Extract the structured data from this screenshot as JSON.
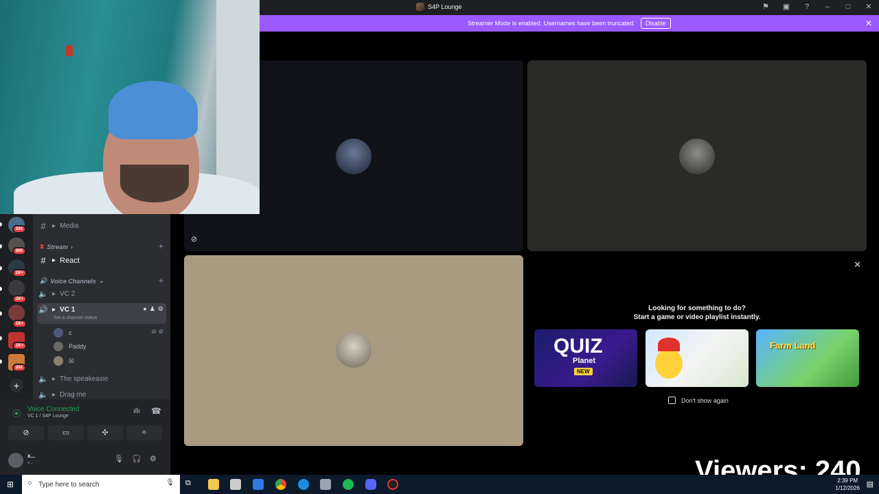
{
  "window": {
    "title": "S4P Lounge"
  },
  "banner": {
    "text": "Streamer Mode is enabled. Usernames have been truncated.",
    "button": "Disable"
  },
  "servers": [
    {
      "badge": "592"
    },
    {
      "badge": "890"
    },
    {
      "badge": "2K+"
    },
    {
      "badge": "2K+"
    },
    {
      "badge": "1K+"
    },
    {
      "badge": "1K+"
    },
    {
      "badge": "282"
    }
  ],
  "channels": {
    "media": "Media",
    "stream_category": "Stream",
    "react": "React",
    "voice_category": "Voice Channels",
    "vc2": "VC 2",
    "vc1": "VC 1",
    "vc1_status": "Set a channel status",
    "speakeasie": "The speakeasie",
    "dragme": "Drag me",
    "members": [
      {
        "name": "c"
      },
      {
        "name": "Paddy"
      },
      {
        "name": "☒"
      }
    ]
  },
  "voice": {
    "status": "Voice Connected",
    "location": "VC 1 / S4P Lounge"
  },
  "user": {
    "name": "x...",
    "status": "x..."
  },
  "activity": {
    "heading1": "Looking for something to do?",
    "heading2": "Start a game or video playlist instantly.",
    "games": [
      {
        "title": "QUIZ",
        "subtitle": "Planet",
        "tag": "NEW"
      },
      {
        "title": ""
      },
      {
        "title": "Farm Land"
      }
    ],
    "dont_show": "Don't show again"
  },
  "overlay": {
    "viewers": "Viewers: 240"
  },
  "taskbar": {
    "search_placeholder": "Type here to search",
    "time": "2:39 PM",
    "date": "1/12/2026"
  },
  "colors": {
    "banner": "#9b59ff",
    "voice_green": "#23a55a",
    "badge_red": "#f23f42"
  }
}
